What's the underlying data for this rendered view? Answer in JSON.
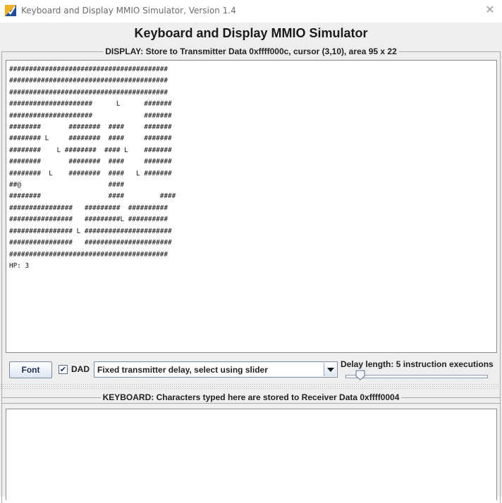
{
  "window": {
    "title": "Keyboard and Display MMIO Simulator, Version 1.4",
    "close_glyph": "✕"
  },
  "main_title": "Keyboard and Display MMIO Simulator",
  "display": {
    "legend": "DISPLAY: Store to Transmitter Data 0xffff000c, cursor (3,10), area 95 x 22",
    "lines": [
      "########################################",
      "########################################",
      "########################################",
      "#####################      L      #######",
      "#####################             #######",
      "########       ########  ####     #######",
      "######## L     ########  ####     #######",
      "########    L ########  #### L    #######",
      "########       ########  ####     #######",
      "########  L    ########  ####   L #######",
      "##@                      ####",
      "########                 ####         ####",
      "################   #########  ##########",
      "################   #########L ##########",
      "################ L ######################",
      "################   ######################",
      "########################################",
      "HP: 3"
    ]
  },
  "controls": {
    "font_button": "Font",
    "dad_checked": true,
    "dad_check_glyph": "✔",
    "dad_label": "DAD",
    "delay_mode": "Fixed transmitter delay, select using slider",
    "delay_label": "Delay length: 5 instruction executions",
    "delay_slider_value": 5
  },
  "keyboard": {
    "legend": "KEYBOARD: Characters typed here are stored to Receiver Data 0xffff0004",
    "text": ""
  }
}
